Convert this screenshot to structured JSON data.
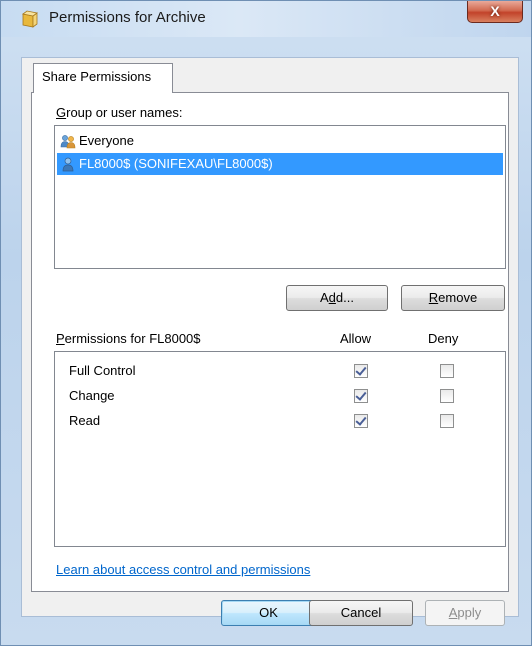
{
  "window": {
    "title": "Permissions for Archive",
    "close_label": "X"
  },
  "tab": {
    "label": "Share Permissions"
  },
  "users": {
    "heading_prefix": "",
    "heading_underline": "G",
    "heading_rest": "roup or user names:",
    "items": [
      {
        "label": "Everyone",
        "icon": "group-users-icon",
        "selected": false
      },
      {
        "label": "FL8000$ (SONIFEXAU\\FL8000$)",
        "icon": "user-icon",
        "selected": true
      }
    ],
    "add_prefix": "A",
    "add_underline": "d",
    "add_rest": "d...",
    "remove_underline": "R",
    "remove_rest": "emove"
  },
  "permissions": {
    "heading_underline": "P",
    "heading_rest": "ermissions for FL8000$",
    "allow_header": "Allow",
    "deny_header": "Deny",
    "rows": [
      {
        "name": "Full Control",
        "allow": true,
        "deny": false
      },
      {
        "name": "Change",
        "allow": true,
        "deny": false
      },
      {
        "name": "Read",
        "allow": true,
        "deny": false
      }
    ]
  },
  "link": {
    "text": "Learn about access control and permissions"
  },
  "footer": {
    "ok_label": "OK",
    "cancel_label": "Cancel",
    "apply_underline": "A",
    "apply_rest": "pply"
  },
  "colors": {
    "selection": "#3399ff",
    "link": "#0066cc",
    "close_button": "#c2432a"
  }
}
